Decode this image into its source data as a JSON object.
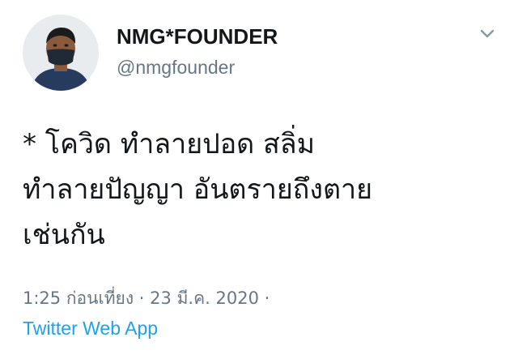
{
  "user": {
    "display_name": "NMG*FOUNDER",
    "handle": "@nmgfounder",
    "avatar_icon": "profile-photo-masked-person"
  },
  "menu_icon": "chevron-down-icon",
  "tweet": {
    "lines": [
      "* โควิด ทำลายปอด สลิ่ม",
      "ทำลายปัญญา อันตรายถึงตาย",
      "เช่นกัน"
    ]
  },
  "meta": {
    "time": "1:25 ก่อนเที่ยง",
    "separator": "·",
    "date": "23 มี.ค. 2020",
    "trailing_separator": "·",
    "source": "Twitter Web App"
  },
  "colors": {
    "text": "#14171a",
    "secondary": "#657786",
    "link": "#1da1f2"
  }
}
